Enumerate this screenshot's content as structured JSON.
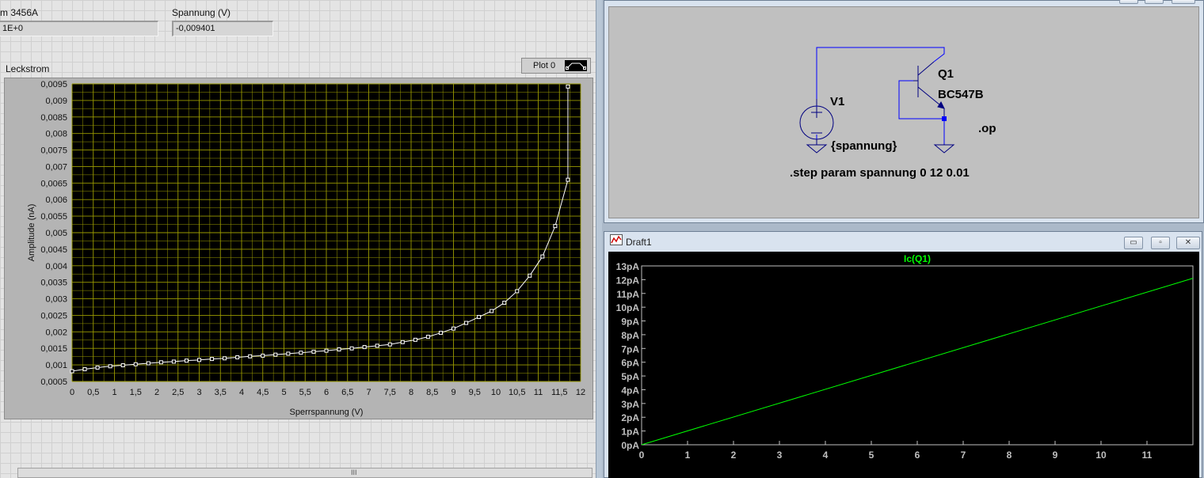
{
  "labview": {
    "instrument_label": "m 3456A",
    "instrument_value": "1E+0",
    "voltage_label": "Spannung (V)",
    "voltage_value": "-0,009401",
    "graph_title": "Leckstrom",
    "legend_label": "Plot 0",
    "scroll_grip": "III"
  },
  "ltspice": {
    "schematic": {
      "source_name": "V1",
      "source_value": "{spannung}",
      "transistor_name": "Q1",
      "transistor_model": "BC547B",
      "directive_op": ".op",
      "directive_step": ".step param spannung 0 12 0.01"
    },
    "draft_title": "Draft1",
    "window_buttons": {
      "minimize": "▭",
      "restore": "▫",
      "close": "✕"
    }
  },
  "colors": {
    "lv_plot_bg": "#000000",
    "lv_grid": "#9a9a00",
    "lv_trace": "#ffffff",
    "spice_bg": "#000000",
    "spice_trace": "#00ff00",
    "wire": "#0000ff",
    "component": "#000080"
  },
  "chart_data": [
    {
      "type": "line",
      "name": "labview-leakage-graph",
      "title": "Leckstrom",
      "xlabel": "Sperrspannung (V)",
      "ylabel": "Amplitude (nA)",
      "xlim": [
        0,
        12
      ],
      "ylim": [
        0.0005,
        0.0095
      ],
      "grid": true,
      "legend": "top-right",
      "x_ticks": [
        "0",
        "0,5",
        "1",
        "1,5",
        "2",
        "2,5",
        "3",
        "3,5",
        "4",
        "4,5",
        "5",
        "5,5",
        "6",
        "6,5",
        "7",
        "7,5",
        "8",
        "8,5",
        "9",
        "9,5",
        "10",
        "10,5",
        "11",
        "11,5",
        "12"
      ],
      "x_tick_values": [
        0,
        0.5,
        1,
        1.5,
        2,
        2.5,
        3,
        3.5,
        4,
        4.5,
        5,
        5.5,
        6,
        6.5,
        7,
        7.5,
        8,
        8.5,
        9,
        9.5,
        10,
        10.5,
        11,
        11.5,
        12
      ],
      "y_ticks": [
        "0,0005",
        "0,001",
        "0,0015",
        "0,002",
        "0,0025",
        "0,003",
        "0,0035",
        "0,004",
        "0,0045",
        "0,005",
        "0,0055",
        "0,006",
        "0,0065",
        "0,007",
        "0,0075",
        "0,008",
        "0,0085",
        "0,009",
        "0,0095"
      ],
      "y_tick_values": [
        0.0005,
        0.001,
        0.0015,
        0.002,
        0.0025,
        0.003,
        0.0035,
        0.004,
        0.0045,
        0.005,
        0.0055,
        0.006,
        0.0065,
        0.007,
        0.0075,
        0.008,
        0.0085,
        0.009,
        0.0095
      ],
      "series": [
        {
          "name": "Plot 0",
          "x": [
            0,
            0.3,
            0.6,
            0.9,
            1.2,
            1.5,
            1.8,
            2.1,
            2.4,
            2.7,
            3.0,
            3.3,
            3.6,
            3.9,
            4.2,
            4.5,
            4.8,
            5.1,
            5.4,
            5.7,
            6.0,
            6.3,
            6.6,
            6.9,
            7.2,
            7.5,
            7.8,
            8.1,
            8.4,
            8.7,
            9.0,
            9.3,
            9.6,
            9.9,
            10.2,
            10.5,
            10.8,
            11.1,
            11.4,
            11.7
          ],
          "y": [
            0.00081,
            0.00087,
            0.00092,
            0.00096,
            0.00099,
            0.00102,
            0.00105,
            0.00108,
            0.0011,
            0.00113,
            0.00115,
            0.00118,
            0.0012,
            0.00123,
            0.00126,
            0.00128,
            0.00131,
            0.00134,
            0.00137,
            0.0014,
            0.00143,
            0.00147,
            0.0015,
            0.00154,
            0.00158,
            0.00162,
            0.00169,
            0.00176,
            0.00185,
            0.00197,
            0.0021,
            0.00227,
            0.00245,
            0.00263,
            0.00288,
            0.00323,
            0.0037,
            0.00428,
            0.0052,
            0.0066
          ]
        },
        {
          "name": "",
          "x": [
            11.7
          ],
          "y": [
            0.00942
          ]
        }
      ]
    },
    {
      "type": "line",
      "name": "ltspice-ic-plot",
      "title": "Ic(Q1)",
      "xlabel": "",
      "ylabel": "",
      "xlim": [
        0,
        12
      ],
      "ylim": [
        0,
        13
      ],
      "grid": false,
      "x_ticks": [
        "0",
        "1",
        "2",
        "3",
        "4",
        "5",
        "6",
        "7",
        "8",
        "9",
        "10",
        "11"
      ],
      "x_tick_values": [
        0,
        1,
        2,
        3,
        4,
        5,
        6,
        7,
        8,
        9,
        10,
        11
      ],
      "y_ticks": [
        "0pA",
        "1pA",
        "2pA",
        "3pA",
        "4pA",
        "5pA",
        "6pA",
        "7pA",
        "8pA",
        "9pA",
        "10pA",
        "11pA",
        "12pA",
        "13pA"
      ],
      "y_tick_values": [
        0,
        1,
        2,
        3,
        4,
        5,
        6,
        7,
        8,
        9,
        10,
        11,
        12,
        13
      ],
      "series": [
        {
          "name": "Ic(Q1)",
          "x": [
            0,
            12
          ],
          "y": [
            0,
            12.1
          ]
        }
      ]
    }
  ]
}
